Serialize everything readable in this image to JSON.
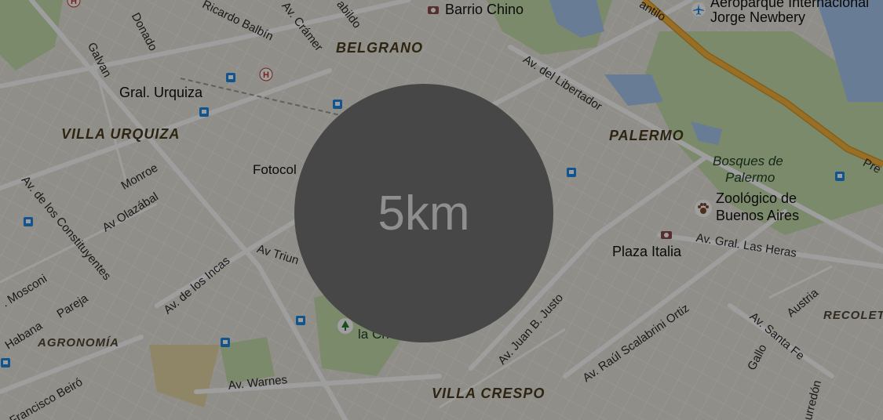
{
  "scale": {
    "label": "5km"
  },
  "districts": {
    "belgrano": "BELGRANO",
    "villa_urquiza": "VILLA URQUIZA",
    "palermo": "PALERMO",
    "agronomia": "AGRONOMÍA",
    "villa_crespo": "VILLA CRESPO",
    "recoleta": "RECOLETA"
  },
  "places": {
    "barrio_chino": "Barrio Chino",
    "aeroparque_line1": "Aeroparque Internacional",
    "aeroparque_line2": "Jorge Newbery",
    "gral_urquiza": "Gral. Urquiza",
    "fotocol": "Fotocol",
    "zoo_line1": "Zoológico de",
    "zoo_line2": "Buenos Aires",
    "plaza_italia": "Plaza Italia",
    "la_chacarita_partial": "la Ch",
    "bosques_line1": "Bosques de",
    "bosques_line2": "Palermo"
  },
  "streets": {
    "donado": "Donado",
    "galvan": "Galvan",
    "ricardo_balbin": "Ricardo Balbín",
    "cramer": "Av. Crámer",
    "cabildo": "abildo",
    "libertador": "Av. del Libertador",
    "cantilo": "antilo",
    "monroe": "Monroe",
    "olazabal": "Av Olazábal",
    "constituyentes": "Av. de los Constituyentes",
    "mosconi": ". Mosconi",
    "habana": "Habana",
    "pareja": "Pareja",
    "de_los_incas": "Av. de los Incas",
    "triunvirato": "Av Triun",
    "juan_b_justo": "Av. Juan B. Justo",
    "scalabrini": "Av. Raúl Scalabrini Ortiz",
    "las_heras": "Av. Gral. Las Heras",
    "santa_fe": "Av. Santa Fe",
    "austria": "Austria",
    "gallo": "Gallo",
    "warnes": "Av. Warnes",
    "beiro": "Francisco Beiró",
    "pueyrredon": "urredón",
    "pre": "Pre"
  },
  "colors": {
    "land": "#e9e5dc",
    "park": "#c9dfae",
    "water": "#a8c8f0",
    "highway": "#f6b43c",
    "overlay": "rgba(0,0,0,0.38)",
    "scale_circle": "#474747",
    "scale_text": "#8f8f8f"
  },
  "icons": [
    "hospital-icon",
    "bus-stop-icon",
    "camera-icon",
    "airplane-icon",
    "zoo-paw-icon",
    "park-tree-icon"
  ]
}
